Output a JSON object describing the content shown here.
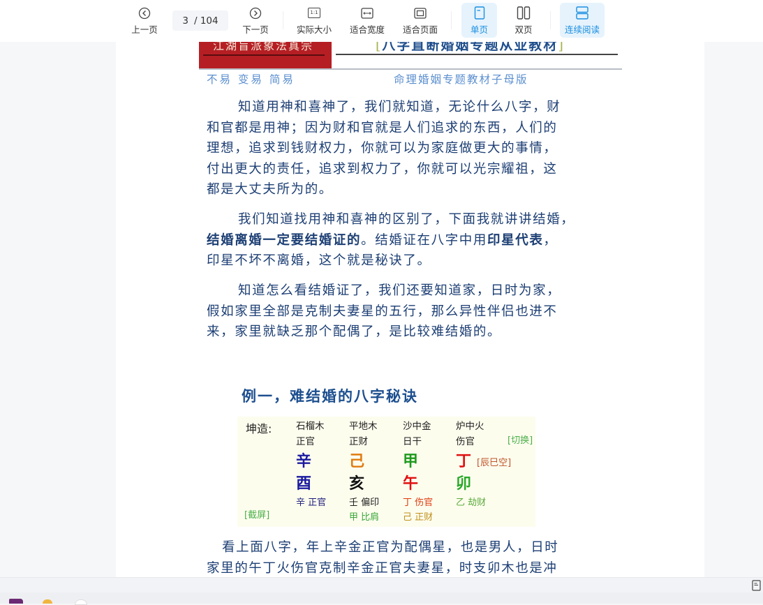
{
  "toolbar": {
    "prev_label": "上一页",
    "current_page": "3",
    "total_pages": "/ 104",
    "next_label": "下一页",
    "actual_size_label": "实际大小",
    "actual_size_icon_text": "1:1",
    "fit_width_label": "适合宽度",
    "fit_page_label": "适合页面",
    "single_page_label": "单页",
    "double_page_label": "双页",
    "continuous_label": "连续阅读",
    "active_color": "#1a8fe0"
  },
  "document": {
    "header_left": "江湖盲派象法真宗",
    "header_title": "八字直断婚姻专题从业教材",
    "header_title_open": "[",
    "header_title_close": "]",
    "sub_left": "不易 变易 简易",
    "sub_right": "命理婚姻专题教材子母版",
    "para1": [
      "知道用神和喜神了，我们就知道，无论什么八字，财",
      "和官都是用神；因为财和官就是人们追求的东西，人们的",
      "理想，追求到钱财权力，你就可以为家庭做更大的事情，",
      "付出更大的责任，追求到权力了，你就可以光宗耀祖，这",
      "都是大丈夫所为的。"
    ],
    "para2": {
      "line1": "我们知道找用神和喜神的区别了，下面我就讲讲结婚，",
      "line2_bold1": "结婚离婚一定要结婚证的",
      "line2_mid": "。结婚证在八字中用",
      "line2_bold2": "印星代表",
      "line2_end": "，",
      "line3": "印星不坏不离婚，这个就是秘诀了。"
    },
    "para3": [
      "知道怎么看结婚证了，我们还要知道家，日时为家，",
      "假如家里全部是克制夫妻星的五行，那么异性伴侣也进不",
      "来，家里就缺乏那个配偶了，是比较难结婚的。"
    ],
    "example_title": "例一，难结婚的八字秘诀",
    "bazi": {
      "label": "坤造:",
      "switch_link": "[切换]",
      "screenshot_link": "[截屏]",
      "kong": "[辰巳空]",
      "pillars": [
        {
          "nayin": "石榴木",
          "shishen": "正官",
          "stem": "辛",
          "stem_color": "#1a1aa0",
          "branch": "酉",
          "branch_color": "#1a1aa0",
          "hidden": [
            {
              "text": "辛 正官",
              "color": "#1a1a7a"
            }
          ]
        },
        {
          "nayin": "平地木",
          "shishen": "正财",
          "stem": "己",
          "stem_color": "#e07b10",
          "branch": "亥",
          "branch_color": "#111111",
          "hidden": [
            {
              "text": "壬 偏印",
              "color": "#222222"
            },
            {
              "text": "甲 比肩",
              "color": "#3aa83a"
            }
          ]
        },
        {
          "nayin": "沙中金",
          "shishen": "日干",
          "stem": "甲",
          "stem_color": "#1e9a1e",
          "branch": "午",
          "branch_color": "#e01010",
          "hidden": [
            {
              "text": "丁 伤官",
              "color": "#e03a10"
            },
            {
              "text": "己 正财",
              "color": "#c0901a"
            }
          ]
        },
        {
          "nayin": "炉中火",
          "shishen": "伤官",
          "stem": "丁",
          "stem_color": "#e01010",
          "branch": "卯",
          "branch_color": "#2aa82a",
          "hidden": [
            {
              "text": "乙 劫财",
              "color": "#5aaa3a"
            }
          ]
        }
      ]
    },
    "para4": [
      "看上面八字，年上辛金正官为配偶星，也是男人，日时",
      "家里的午丁火伤官克制辛金正官夫妻星，时支卯木也是冲"
    ]
  }
}
